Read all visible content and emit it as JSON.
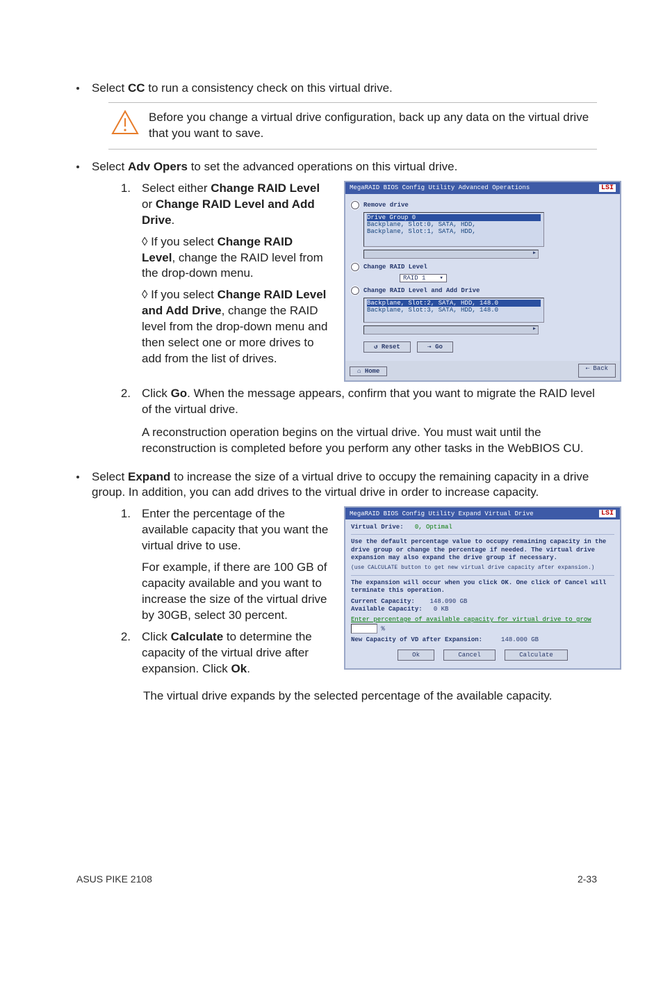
{
  "bullets": {
    "cc": {
      "prefix": "Select ",
      "bold": "CC",
      "suffix": " to run a consistency check on this virtual drive."
    },
    "warning": "Before you change a virtual drive configuration, back up any data on the virtual drive that you want to save.",
    "adv": {
      "prefix": "Select ",
      "bold": "Adv Opers",
      "suffix": " to set the advanced operations on this virtual drive."
    },
    "expand": {
      "prefix": "Select ",
      "bold": "Expand",
      "suffix": " to increase the size of a virtual drive to occupy the remaining capacity in a drive group. In addition, you can add drives to the virtual drive in order to increase capacity."
    }
  },
  "adv_steps": {
    "s1": {
      "num": "1.",
      "line_a": "Select either ",
      "bold_a": "Change RAID Level",
      "mid_a": " or ",
      "bold_b": "Change RAID Level and Add Drive",
      "end_a": ".",
      "sub1_pre": "◊ If you select ",
      "sub1_b": "Change RAID Level",
      "sub1_post": ", change the RAID level from the drop-down menu.",
      "sub2_pre": "◊ If you select ",
      "sub2_b": "Change RAID Level and Add Drive",
      "sub2_post": ", change the RAID level from the drop-down menu and then select one or more drives to add from the list of drives."
    },
    "s2": {
      "num": "2.",
      "pre": "Click ",
      "bold": "Go",
      "post": ". When the message appears, confirm that you want to migrate the RAID level of the virtual drive.",
      "para2": "A reconstruction operation begins on the virtual drive. You must wait until the reconstruction is completed before you perform any other tasks in the WebBIOS CU."
    }
  },
  "expand_steps": {
    "s1": {
      "num": "1.",
      "p1": "Enter the percentage of the available capacity that you want the virtual drive to use.",
      "p2": "For example, if there are 100 GB of capacity available and you want to increase the size of the virtual drive by 30GB, select 30 percent."
    },
    "s2": {
      "num": "2.",
      "pre": "Click ",
      "bold": "Calculate",
      "mid": " to determine the capacity of the virtual drive after expansion. Click ",
      "bold2": "Ok",
      "end": "."
    },
    "tail": "The virtual drive expands by the selected percentage of the available capacity."
  },
  "mock1": {
    "title": "MegaRAID BIOS Config Utility Advanced Operations",
    "brand": "LSI",
    "opt_remove": "Remove drive",
    "tree1_sel": "Drive Group 0",
    "tree1_l2": "Backplane, Slot:0, SATA, HDD,",
    "tree1_l3": "Backplane, Slot:1, SATA, HDD,",
    "opt_change": "Change RAID Level",
    "raid_value": "RAID 1",
    "opt_change_add": "Change RAID Level and Add Drive",
    "tree2_l1": "Backplane, Slot:2, SATA, HDD, 148.0",
    "tree2_l2": "Backplane, Slot:3, SATA, HDD, 148.0",
    "btn_reset": "Reset",
    "btn_go": "Go",
    "btn_home": "Home",
    "btn_back": "Back"
  },
  "mock2": {
    "title": "MegaRAID BIOS Config Utility Expand Virtual Drive",
    "brand": "LSI",
    "vd_label": "Virtual Drive:",
    "vd_value": "0, Optimal",
    "help1": "Use the default percentage value to occupy remaining capacity in the drive group or change the percentage if needed. The virtual drive expansion may also expand the drive group if necessary.",
    "help1_sub": "(use CALCULATE button to get new virtual drive capacity after expansion.)",
    "help2": "The expansion will occur when you click OK. One click of Cancel will terminate this operation.",
    "cur_label": "Current Capacity:",
    "cur_val": "148.090 GB",
    "avail_label": "Available Capacity:",
    "avail_val": "0 KB",
    "enter_pct": "Enter percentage of available capacity for virtual drive to grow",
    "pct_suffix": "%",
    "newcap_label": "New Capacity of VD after Expansion:",
    "newcap_val": "148.000 GB",
    "btn_ok": "Ok",
    "btn_cancel": "Cancel",
    "btn_calc": "Calculate"
  },
  "footer": {
    "left": "ASUS PIKE 2108",
    "right": "2-33"
  }
}
